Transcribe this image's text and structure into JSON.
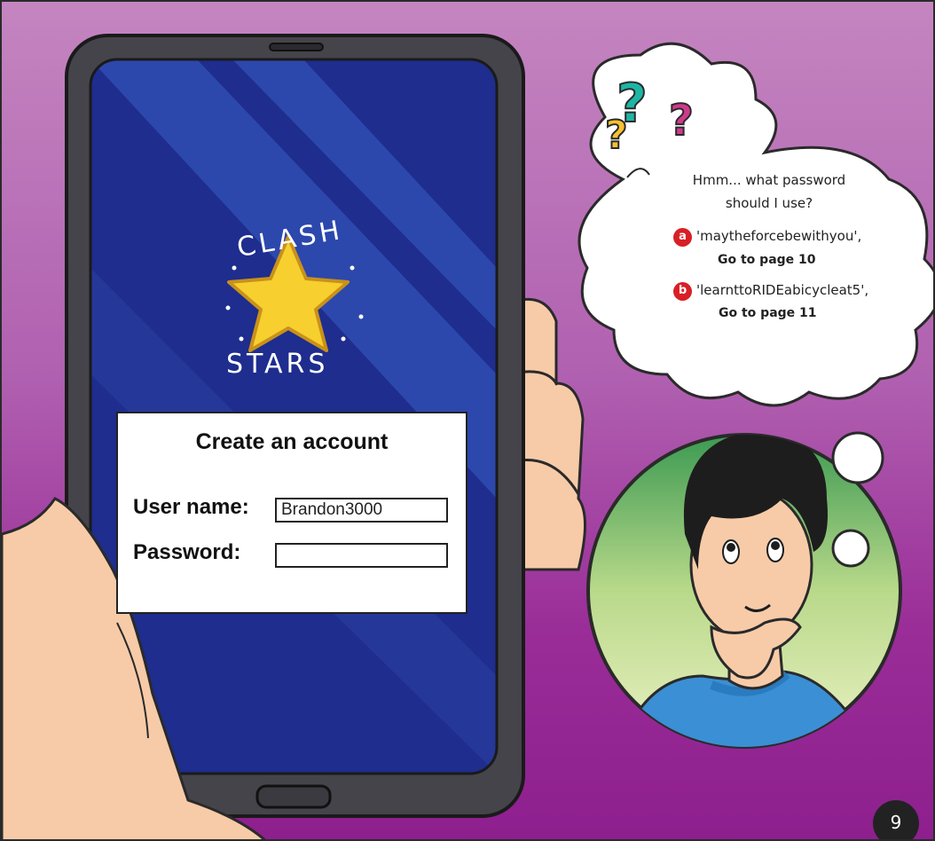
{
  "logo": {
    "top_text": "CLASH",
    "bottom_text": "STARS"
  },
  "form": {
    "title": "Create an account",
    "username_label": "User name:",
    "username_value": "Brandon3000",
    "password_label": "Password:",
    "password_value": ""
  },
  "thought": {
    "line1": "Hmm... what password",
    "line2": "should I use?",
    "options": [
      {
        "badge": "a",
        "text": "'maytheforcebewithyou',",
        "goto": "Go to page 10"
      },
      {
        "badge": "b",
        "text": "'learnttoRIDEabicycleat5',",
        "goto": "Go to page 11"
      }
    ]
  },
  "page_number": "9",
  "colors": {
    "background_top": "#c485c0",
    "background_bottom": "#8e1f8e",
    "screen_blue": "#1e2d8e",
    "star_yellow": "#f7cf2e",
    "badge_red": "#d81f26"
  }
}
